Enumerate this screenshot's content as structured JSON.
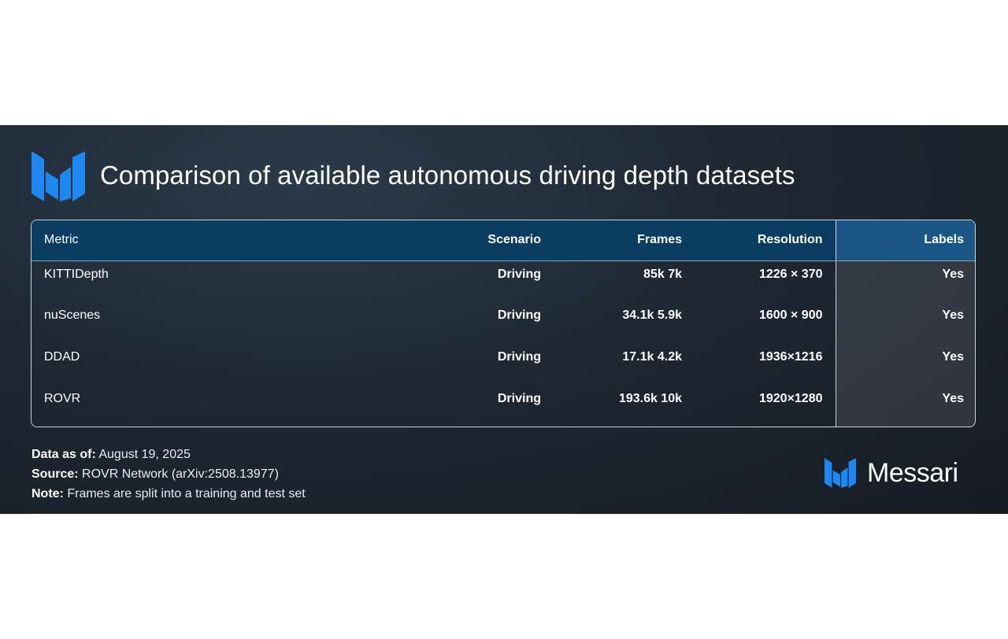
{
  "brand": {
    "name": "Messari",
    "accent_color": "#1e88f0",
    "logo_icon": "messari-logo-icon"
  },
  "chart_data": {
    "type": "table",
    "title": "Comparison of available autonomous driving depth datasets",
    "columns": [
      "Metric",
      "Scenario",
      "Frames",
      "Resolution",
      "Labels"
    ],
    "rows": [
      [
        "KITTIDepth",
        "Driving",
        "85k 7k",
        "1226 × 370",
        "Yes"
      ],
      [
        "nuScenes",
        "Driving",
        "34.1k 5.9k",
        "1600 × 900",
        "Yes"
      ],
      [
        "DDAD",
        "Driving",
        "17.1k 4.2k",
        "1936×1216",
        "Yes"
      ],
      [
        "ROVR",
        "Driving",
        "193.6k 10k",
        "1920×1280",
        "Yes"
      ]
    ]
  },
  "footer": {
    "data_as_of_label": "Data as of:",
    "data_as_of_value": " August 19, 2025",
    "source_label": "Source:",
    "source_value": " ROVR Network (arXiv:2508.13977)",
    "note_label": "Note:",
    "note_value": " Frames are split into a training and test set"
  }
}
